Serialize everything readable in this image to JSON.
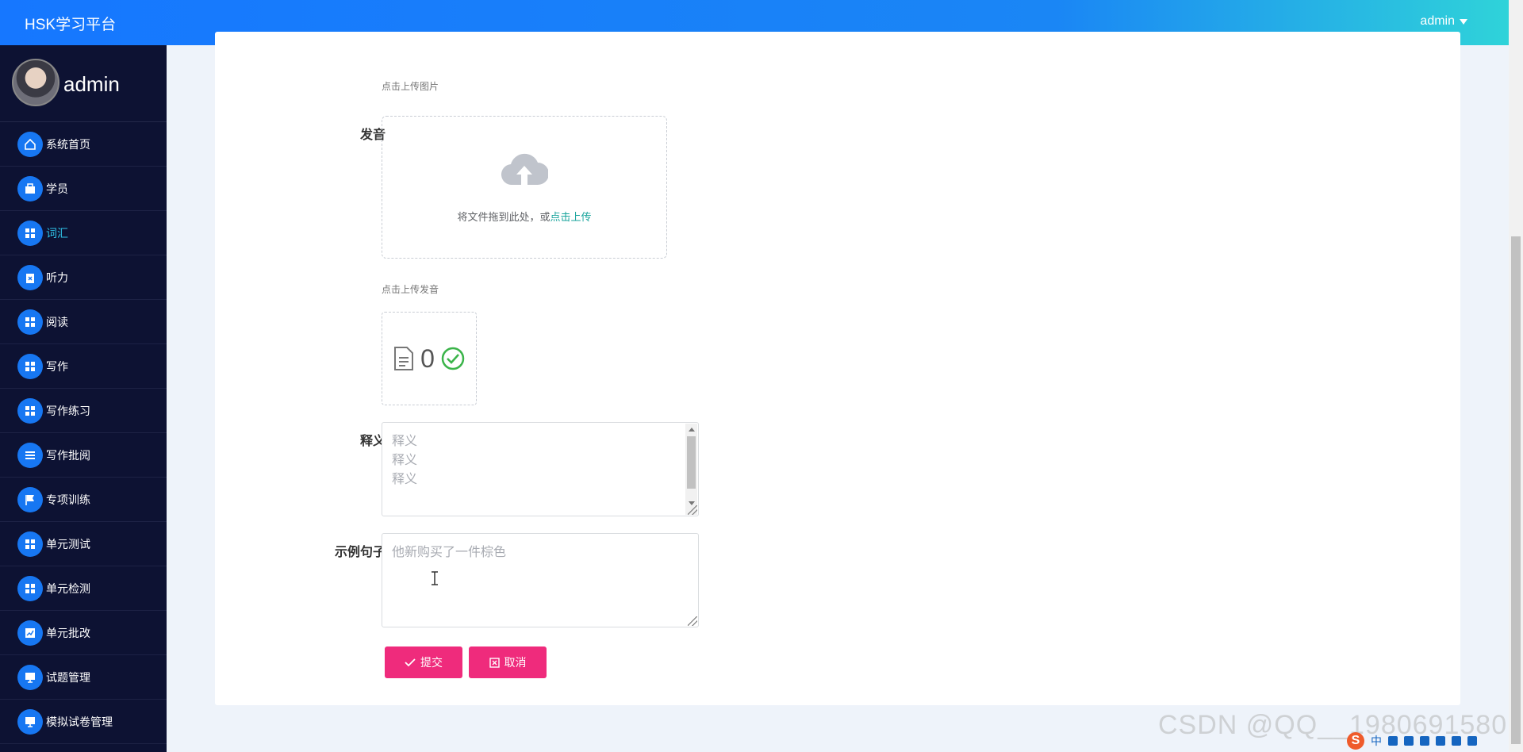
{
  "header": {
    "brand": "HSK学习平台",
    "user": "admin"
  },
  "sidebar": {
    "profile_name": "admin",
    "items": [
      {
        "label": "系统首页",
        "icon": "home-icon"
      },
      {
        "label": "学员",
        "icon": "briefcase-icon"
      },
      {
        "label": "词汇",
        "icon": "grid-icon",
        "active": true
      },
      {
        "label": "听力",
        "icon": "clipboard-icon"
      },
      {
        "label": "阅读",
        "icon": "grid-icon"
      },
      {
        "label": "写作",
        "icon": "grid-icon"
      },
      {
        "label": "写作练习",
        "icon": "grid-icon"
      },
      {
        "label": "写作批阅",
        "icon": "list-icon"
      },
      {
        "label": "专项训练",
        "icon": "flag-icon"
      },
      {
        "label": "单元测试",
        "icon": "grid-icon"
      },
      {
        "label": "单元检测",
        "icon": "grid-icon"
      },
      {
        "label": "单元批改",
        "icon": "chart-icon"
      },
      {
        "label": "试题管理",
        "icon": "monitor-icon"
      },
      {
        "label": "模拟试卷管理",
        "icon": "monitor-icon"
      }
    ]
  },
  "form": {
    "image_hint": "点击上传图片",
    "pronunciation_label": "发音",
    "upload_text": "将文件拖到此处，或",
    "upload_link": "点击上传",
    "audio_hint": "点击上传发音",
    "file_count": "0",
    "meaning_label": "释义",
    "meaning_lines": [
      "释义",
      "释义",
      "释义"
    ],
    "example_label": "示例句子",
    "example_placeholder": "他新购买了一件棕色",
    "submit_label": "提交",
    "cancel_label": "取消"
  },
  "watermark": "CSDN @QQ__1980691580",
  "tray": {
    "ime": "中",
    "logo": "S"
  },
  "colors": {
    "header_start": "#1677ff",
    "header_end": "#2fd3d9",
    "sidebar_bg": "#0d1233",
    "menu_icon_bg": "#1777f2",
    "active_text": "#2fc3e8",
    "button": "#ef2b7c",
    "link": "#17a39b"
  }
}
